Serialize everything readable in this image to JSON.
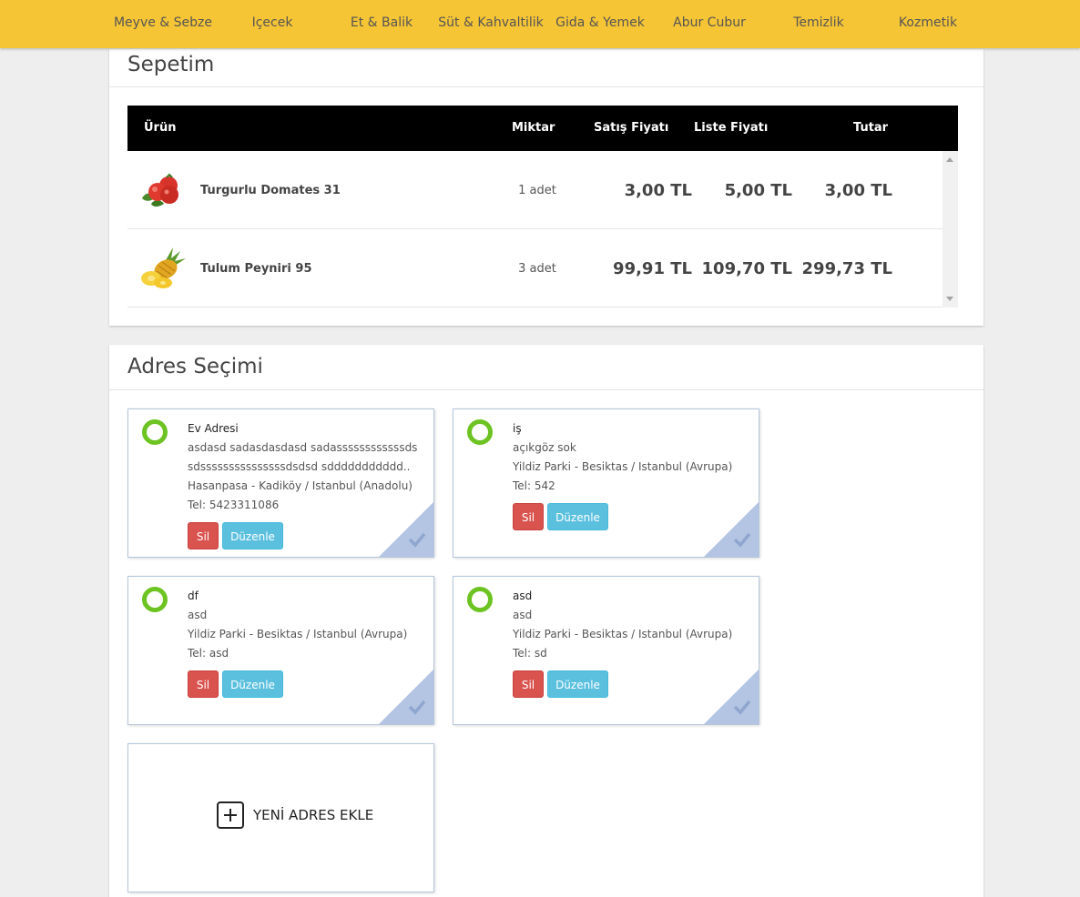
{
  "nav": {
    "items": [
      {
        "label": "Meyve & Sebze"
      },
      {
        "label": "Içecek"
      },
      {
        "label": "Et & Balik"
      },
      {
        "label": "Süt & Kahvaltilik"
      },
      {
        "label": "Gida & Yemek"
      },
      {
        "label": "Abur Cubur"
      },
      {
        "label": "Temizlik"
      },
      {
        "label": "Kozmetik"
      }
    ]
  },
  "cart": {
    "title": "Sepetim",
    "columns": {
      "product": "Ürün",
      "quantity": "Miktar",
      "sale_price": "Satış Fiyatı",
      "list_price": "Liste Fiyatı",
      "total": "Tutar"
    },
    "rows": [
      {
        "name": "Turgurlu Domates 31",
        "image": "tomato-image",
        "quantity": "1 adet",
        "sale_price": "3,00 TL",
        "list_price": "5,00 TL",
        "total": "3,00 TL"
      },
      {
        "name": "Tulum Peyniri 95",
        "image": "pineapple-image",
        "quantity": "3 adet",
        "sale_price": "99,91 TL",
        "list_price": "109,70 TL",
        "total": "299,73 TL"
      }
    ]
  },
  "addresses": {
    "title": "Adres Seçimi",
    "delete_label": "Sil",
    "edit_label": "Düzenle",
    "cards": [
      {
        "name": "Ev Adresi",
        "lines": [
          "asdasd sadasdasdasd sadassssssssssssds",
          "sdsssssssssssssssdsdsd sddddddddddd..",
          "Hasanpasa - Kadiköy / Istanbul (Anadolu)",
          "Tel: 5423311086"
        ]
      },
      {
        "name": "iş",
        "lines": [
          "açıkgöz sok",
          "Yildiz Parki - Besiktas / Istanbul (Avrupa)",
          "Tel: 542"
        ]
      },
      {
        "name": "df",
        "lines": [
          "asd",
          "Yildiz Parki - Besiktas / Istanbul (Avrupa)",
          "Tel: asd"
        ]
      },
      {
        "name": "asd",
        "lines": [
          "asd",
          "Yildiz Parki - Besiktas / Istanbul (Avrupa)",
          "Tel: sd"
        ]
      }
    ],
    "add_label": "YENİ ADRES EKLE",
    "colors": {
      "radio": "#6cc322",
      "delete": "#d9534f",
      "edit": "#5bc0de",
      "corner": "#b3c5e3"
    }
  }
}
